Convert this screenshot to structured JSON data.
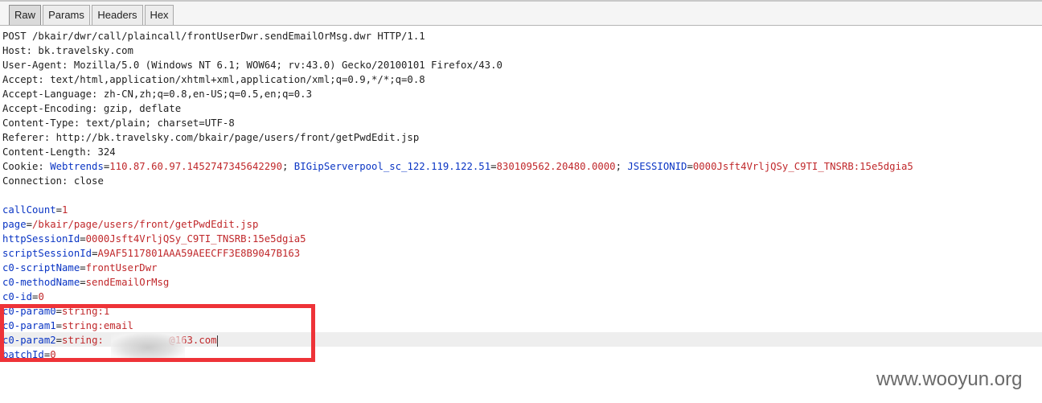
{
  "tabs": [
    {
      "label": "Raw",
      "active": true
    },
    {
      "label": "Params",
      "active": false
    },
    {
      "label": "Headers",
      "active": false
    },
    {
      "label": "Hex",
      "active": false
    }
  ],
  "request": {
    "request_line": "POST /bkair/dwr/call/plaincall/frontUserDwr.sendEmailOrMsg.dwr HTTP/1.1",
    "host": "Host: bk.travelsky.com",
    "user_agent": "User-Agent: Mozilla/5.0 (Windows NT 6.1; WOW64; rv:43.0) Gecko/20100101 Firefox/43.0",
    "accept": "Accept: text/html,application/xhtml+xml,application/xml;q=0.9,*/*;q=0.8",
    "accept_language": "Accept-Language: zh-CN,zh;q=0.8,en-US;q=0.5,en;q=0.3",
    "accept_encoding": "Accept-Encoding: gzip, deflate",
    "content_type": "Content-Type: text/plain; charset=UTF-8",
    "referer": "Referer: http://bk.travelsky.com/bkair/page/users/front/getPwdEdit.jsp",
    "content_length": "Content-Length: 324",
    "cookie_prefix": "Cookie: ",
    "cookies": [
      {
        "name": "Webtrends",
        "value": "110.87.60.97.1452747345642290"
      },
      {
        "name": "BIGipServerpool_sc_122.119.122.51",
        "value": "830109562.20480.0000"
      },
      {
        "name": "JSESSIONID",
        "value": "0000Jsft4VrljQSy_C9TI_TNSRB:15e5dgia5"
      }
    ],
    "connection": "Connection: close"
  },
  "body_params": [
    {
      "name": "callCount",
      "value": "1"
    },
    {
      "name": "page",
      "value": "/bkair/page/users/front/getPwdEdit.jsp"
    },
    {
      "name": "httpSessionId",
      "value": "0000Jsft4VrljQSy_C9TI_TNSRB:15e5dgia5"
    },
    {
      "name": "scriptSessionId",
      "value": "A9AF5117801AAA59AEECFF3E8B9047B163"
    },
    {
      "name": "c0-scriptName",
      "value": "frontUserDwr"
    },
    {
      "name": "c0-methodName",
      "value": "sendEmailOrMsg"
    },
    {
      "name": "c0-id",
      "value": "0"
    },
    {
      "name": "c0-param0",
      "value": "string:1"
    },
    {
      "name": "c0-param1",
      "value": "string:email"
    },
    {
      "name": "c0-param2",
      "value": "string:           @163.com"
    },
    {
      "name": "batchId",
      "value": "0"
    }
  ],
  "watermark": "www.wooyun.org"
}
